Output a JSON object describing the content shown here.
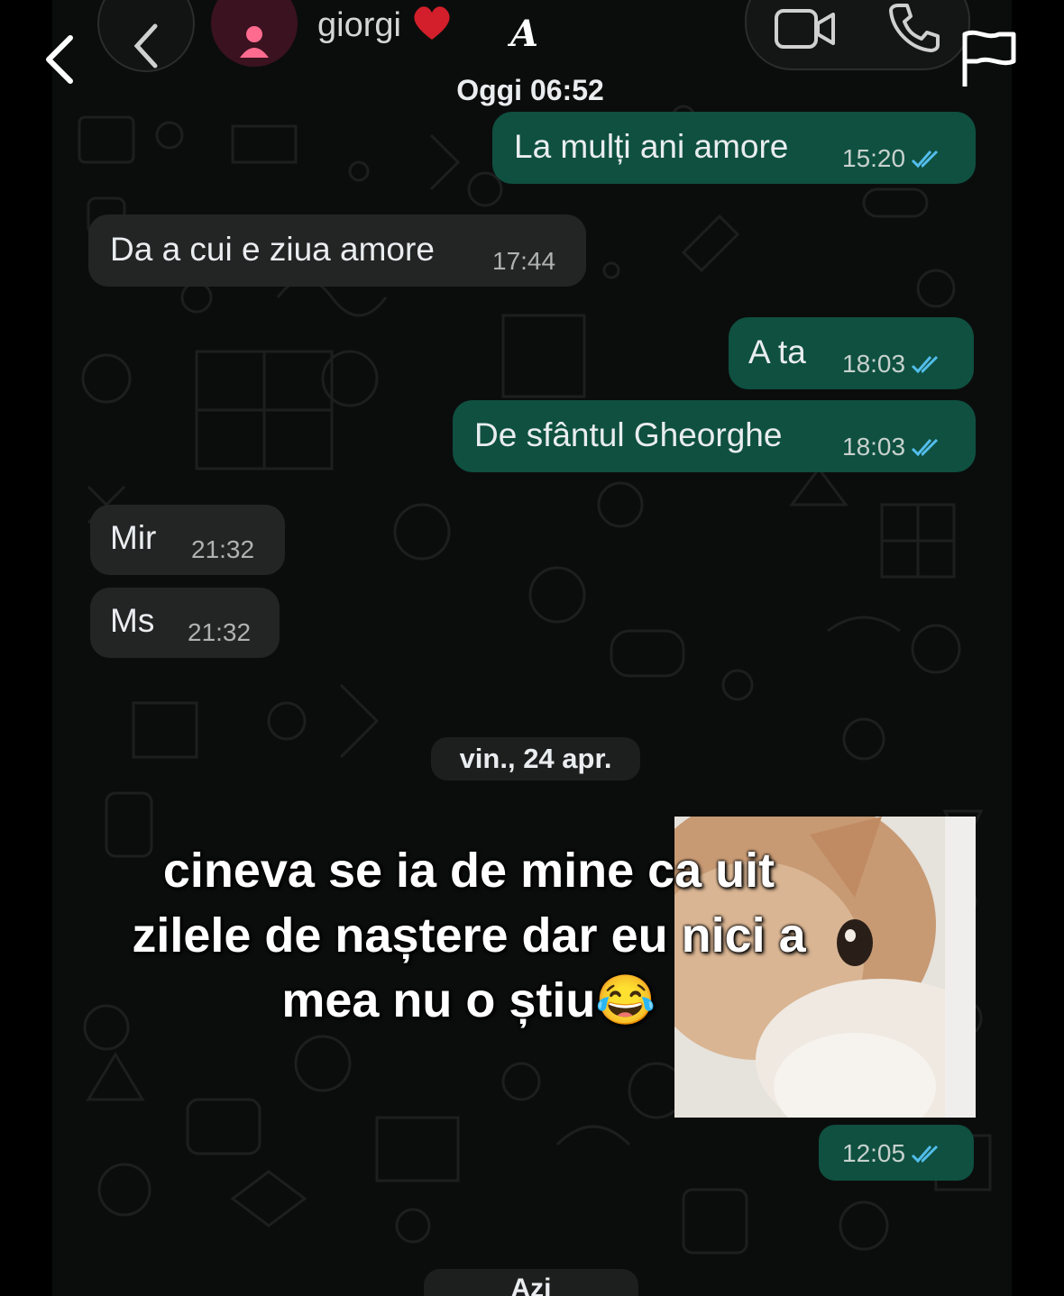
{
  "header": {
    "contact_name": "giorgi",
    "heart_icon": "red-heart",
    "script_letter": "A",
    "time_label": "Oggi 06:52",
    "icons": [
      "back-icon",
      "avatar-person-icon",
      "video-call-icon",
      "phone-icon",
      "flag-icon"
    ]
  },
  "messages": [
    {
      "dir": "out",
      "text": "La mulți ani amore",
      "time": "15:20",
      "status": "read"
    },
    {
      "dir": "in",
      "text": "Da a cui e ziua amore",
      "time": "17:44"
    },
    {
      "dir": "out",
      "text": "A ta",
      "time": "18:03",
      "status": "read"
    },
    {
      "dir": "out",
      "text": "De sfântul Gheorghe",
      "time": "18:03",
      "status": "read"
    },
    {
      "dir": "in",
      "text": "Mir",
      "time": "21:32"
    },
    {
      "dir": "in",
      "text": "Ms",
      "time": "21:32"
    }
  ],
  "date_separator": "vin., 24 apr.",
  "sticker_message": {
    "time": "12:05",
    "status": "read"
  },
  "today_separator": "Azi",
  "overlay_caption": {
    "line1": "cineva se ia de mine ca uit",
    "line2": "zilele de naștere dar eu nici a",
    "line3": "mea nu o știu",
    "emoji": "😂"
  },
  "colors": {
    "outgoing_bubble": "#0f5040",
    "incoming_bubble": "#222524",
    "read_tick": "#53bdeb",
    "background": "#0b0d0c"
  }
}
